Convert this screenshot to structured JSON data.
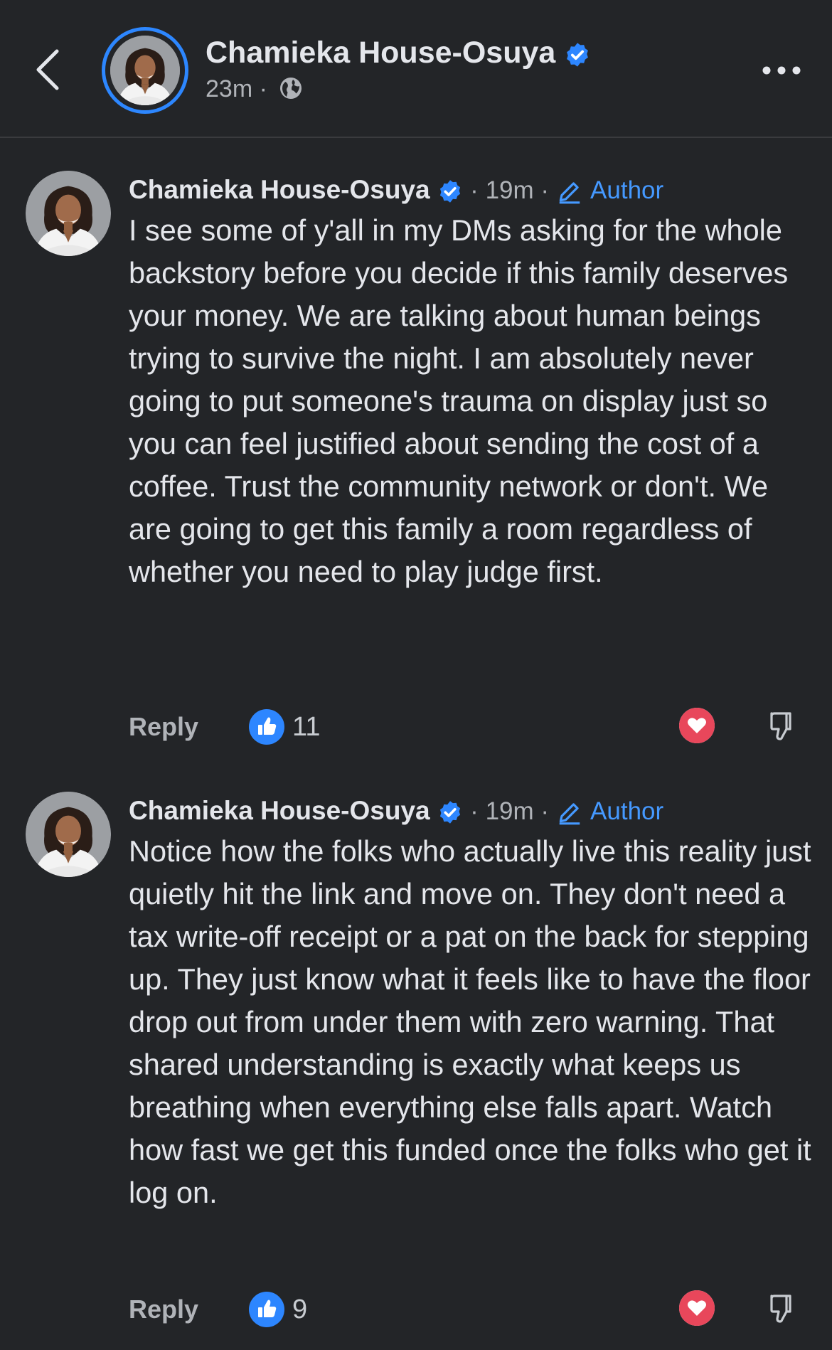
{
  "header": {
    "name": "Chamieka House-Osuya",
    "time": "23m",
    "separator": "·",
    "privacy_icon": "globe-icon",
    "back_icon": "chevron-left-icon",
    "more_icon": "more-dots-icon"
  },
  "colors": {
    "background": "#232528",
    "accent_blue": "#2d86ff",
    "text_primary": "#e4e6eb",
    "text_secondary": "#b0b3b8",
    "author_blue": "#4599ff",
    "heart_red": "#e8475b"
  },
  "comments": [
    {
      "author": "Chamieka House-Osuya",
      "time": "19m",
      "badge": "Author",
      "badge_icon": "pencil-icon",
      "text": "I see some of y'all in my DMs asking for the whole backstory before you decide if this family deserves your money. We are talking about human beings trying to survive the night. I am absolutely never going to put someone's trauma on display just so you can feel justified about sending the cost of a coffee. Trust the community network or don't. We are going to get this family a room regardless of whether you need to play judge first.",
      "reply_label": "Reply",
      "like_count": "11",
      "reaction_icon": "like-icon",
      "heart_icon": "heart-icon",
      "dislike_icon": "dislike-icon"
    },
    {
      "author": "Chamieka House-Osuya",
      "time": "19m",
      "badge": "Author",
      "badge_icon": "pencil-icon",
      "text": "Notice how the folks who actually live this reality just quietly hit the link and move on. They don't need a tax write-off receipt or a pat on the back for stepping up. They just know what it feels like to have the floor drop out from under them with zero warning. That shared understanding is exactly what keeps us breathing when everything else falls apart. Watch how fast we get this funded once the folks who get it log on.",
      "reply_label": "Reply",
      "like_count": "9",
      "reaction_icon": "like-icon",
      "heart_icon": "heart-icon",
      "dislike_icon": "dislike-icon"
    }
  ]
}
